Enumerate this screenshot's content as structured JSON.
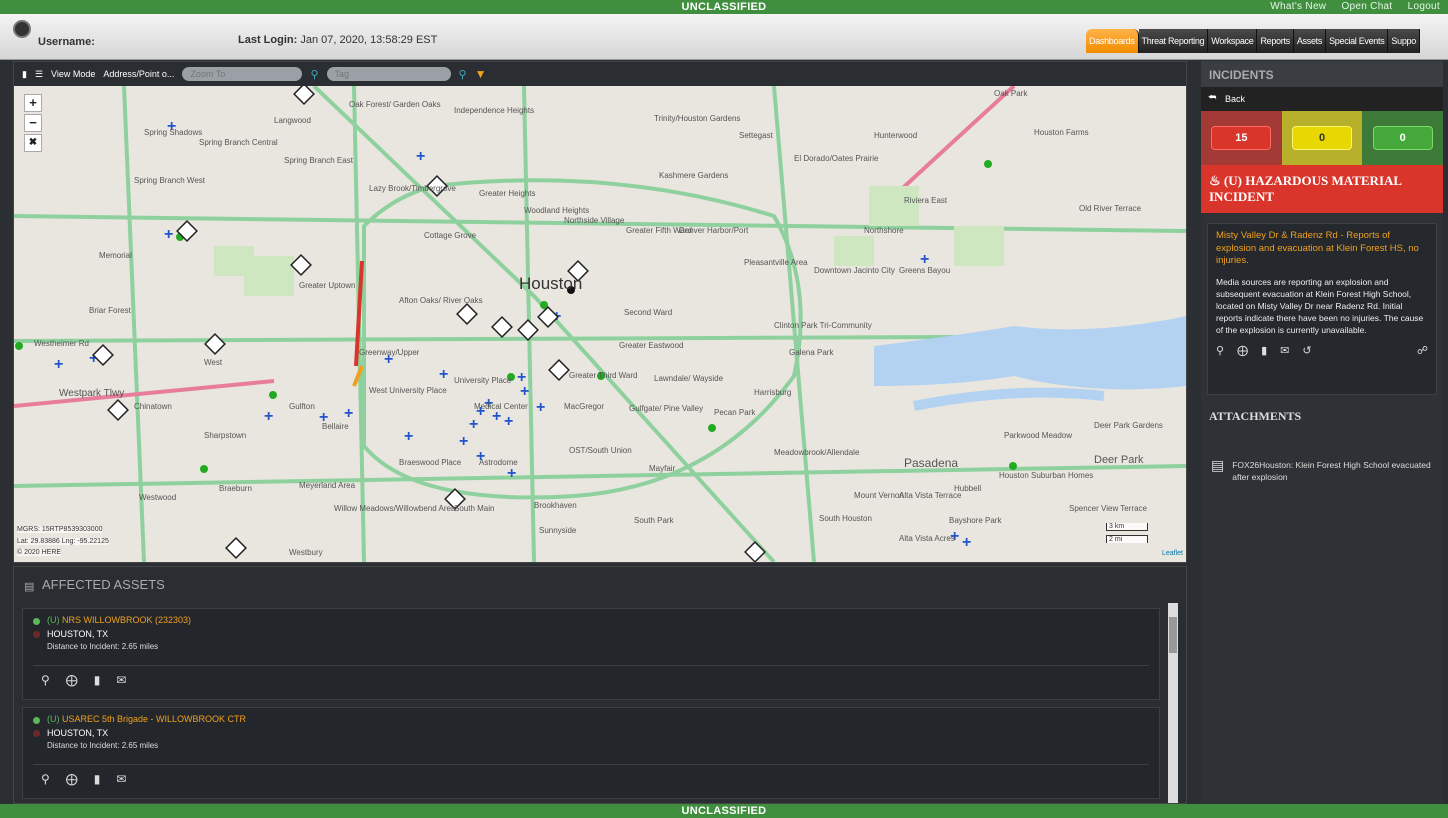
{
  "banner": {
    "top": "UNCLASSIFIED",
    "bottom": "UNCLASSIFIED"
  },
  "top_links": [
    "What's New",
    "Open Chat",
    "Logout"
  ],
  "header": {
    "username_label": "Username:",
    "last_login_label": "Last Login:",
    "last_login_value": "Jan 07, 2020, 13:58:29 EST"
  },
  "tabs": [
    "Dashboards",
    "Threat Reporting",
    "Workspace",
    "Reports",
    "Assets",
    "Special Events",
    "Suppo"
  ],
  "map_toolbar": {
    "view_mode": "View Mode",
    "address": "Address/Point o...",
    "zoom_placeholder": "Zoom To",
    "tag_placeholder": "Tag"
  },
  "map": {
    "zoom_in": "+",
    "zoom_out": "−",
    "city": "Houston",
    "labels": [
      "Spring Shadows",
      "Spring Branch Central",
      "Spring Branch East",
      "Spring Branch West",
      "Langwood",
      "Oak Forest/ Garden Oaks",
      "Independence Heights",
      "Trinity/Houston Gardens",
      "Settegast",
      "Hunterwood",
      "Houston Farms",
      "El Dorado/Oates Prairie",
      "Kashmere Gardens",
      "Lazy Brook/Timbergrove",
      "Greater Heights",
      "Woodland Heights",
      "Northside Village",
      "Greater Fifth Ward",
      "Denver Harbor/Port",
      "Riviera East",
      "Northshore",
      "Old River Terrace",
      "Memorial",
      "Greater Uptown",
      "Afton Oaks/ River Oaks",
      "Second Ward",
      "Pleasantville Area",
      "Downtown Jacinto City",
      "Greens Bayou",
      "Briar Forest",
      "Westheimer Rd",
      "West",
      "Greenway/Upper",
      "Greater Eastwood",
      "Clinton Park Tri-Community",
      "Galena Park",
      "Westpark Tlwy",
      "Chinatown",
      "West University Place",
      "University Place",
      "Greater Third Ward",
      "Lawndale/ Wayside",
      "Gulfton",
      "Bellaire",
      "MacGregor",
      "Gulfgate/ Pine Valley",
      "Pecan Park",
      "Sharpstown",
      "Medical Center",
      "Harrisburg",
      "Braeswood Place",
      "OST/South Union",
      "Astrodome",
      "Meadowbrook/Allendale",
      "Pasadena",
      "Deer Park",
      "Parkwood Meadow",
      "Braeburn",
      "Meyerland Area",
      "Mayfair",
      "Westwood",
      "Willow Meadows/Willowbend Area",
      "South Main",
      "Brookhaven",
      "Sunnyside",
      "South Park",
      "Mount Vernon",
      "Alta Vista Terrace",
      "South Houston",
      "Hubbell",
      "Houston Suburban Homes",
      "Spencer View Terrace",
      "Bayshore Park",
      "Alta Vista Acres",
      "Westbury",
      "Deer Park Gardens",
      "Cottage Grove",
      "Oak Park"
    ],
    "mgrs": "MGRS: 15RTP8539303000",
    "latlng": "Lat: 29.83886 Lng: -95.22125",
    "copyright": "© 2020 HERE",
    "scale_km": "3 km",
    "scale_mi": "2 mi",
    "leaflet": "Leaflet"
  },
  "assets": {
    "header": "AFFECTED ASSETS",
    "items": [
      {
        "prefix": "(U)",
        "name": "NRS WILLOWBROOK (232303)",
        "location": "HOUSTON, TX",
        "distance": "Distance to Incident: 2.65 miles"
      },
      {
        "prefix": "(U)",
        "name": "USAREC 5th Brigade - WILLOWBROOK CTR",
        "location": "HOUSTON, TX",
        "distance": "Distance to Incident: 2.65 miles"
      }
    ]
  },
  "incidents": {
    "title": "INCIDENTS",
    "back": "Back",
    "counts": {
      "red": "15",
      "yellow": "0",
      "green": "0"
    },
    "colors": {
      "red": "#d9352b",
      "yellow": "#e6d800",
      "green": "#45a83a"
    },
    "heading": "(U) HAZARDOUS MATERIAL INCIDENT",
    "summary": "Misty Valley Dr & Radenz Rd - Reports of explosion and evacuation at Klein Forest HS, no injuries.",
    "description": "Media sources are reporting an explosion and subsequent evacuation at Klein Forest High School, located on Misty Valley Dr near Radenz Rd. Initial reports indicate there have been no injuries. The cause of the explosion is currently unavailable.",
    "attachments_title": "ATTACHMENTS",
    "attachment": "FOX26Houston: Klein Forest High School evacuated after explosion"
  }
}
